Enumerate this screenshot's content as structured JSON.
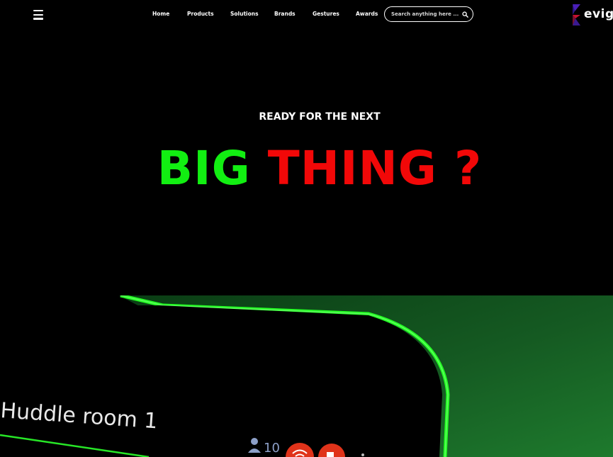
{
  "nav": {
    "items": [
      {
        "label": "Home"
      },
      {
        "label": "Products"
      },
      {
        "label": "Solutions"
      },
      {
        "label": "Brands"
      },
      {
        "label": "Gestures"
      },
      {
        "label": "Awards"
      }
    ]
  },
  "search": {
    "placeholder": "Search anything here ..."
  },
  "logo": {
    "text": "evig"
  },
  "hero": {
    "subtitle": "READY FOR THE NEXT",
    "title_part1": "BIG",
    "title_part2": "THING",
    "title_part3": "?"
  },
  "image": {
    "room_label": "Huddle room 1",
    "participant_count": "10"
  },
  "colors": {
    "accent_green": "#12ef12",
    "accent_red": "#f20808",
    "background": "#000000"
  }
}
